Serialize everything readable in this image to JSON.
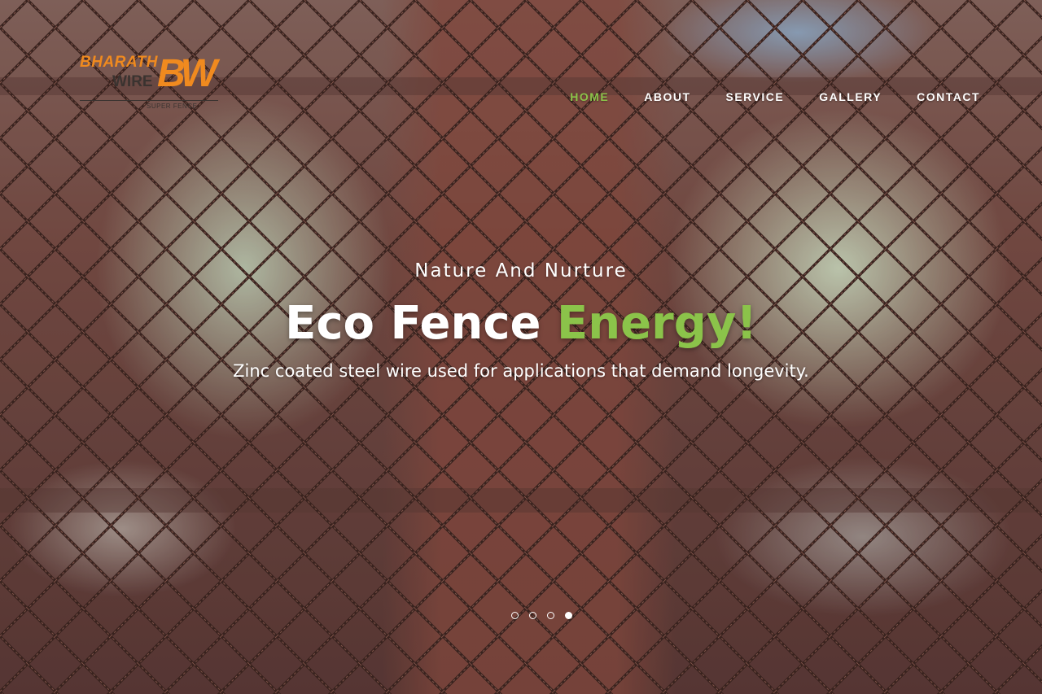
{
  "brand": {
    "name_line1": "BHARATH",
    "name_line2": "WIRE",
    "mark": "BW",
    "tagline": "SUPER FENCE"
  },
  "nav": {
    "items": [
      {
        "label": "HOME",
        "active": true
      },
      {
        "label": "ABOUT",
        "active": false
      },
      {
        "label": "SERVICE",
        "active": false
      },
      {
        "label": "GALLERY",
        "active": false
      },
      {
        "label": "CONTACT",
        "active": false
      }
    ]
  },
  "hero": {
    "subtitle": "Nature And Nurture",
    "headline_main": "Eco Fence",
    "headline_accent": "Energy!",
    "description": "Zinc coated steel wire used for applications that demand longevity."
  },
  "slider": {
    "total_slides": 4,
    "active_slide": 4
  },
  "colors": {
    "accent": "#8bc34a",
    "brand_orange": "#f08a1f",
    "text": "#ffffff"
  }
}
